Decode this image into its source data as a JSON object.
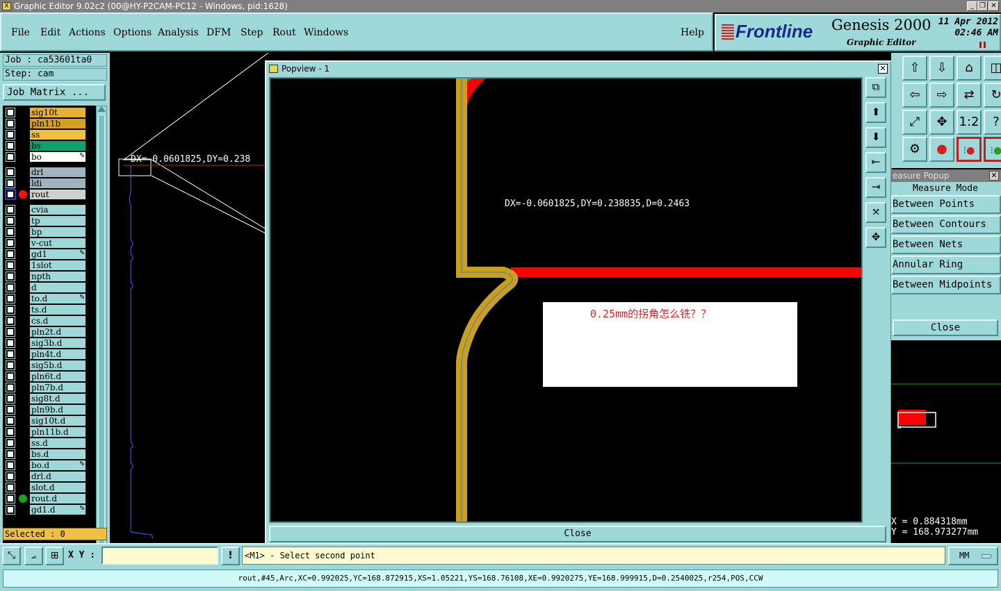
{
  "window": {
    "title": "Graphic Editor 9.02c2 (00@HY-P2CAM-PC12 - Windows, pid:1628)"
  },
  "menu": {
    "items": [
      "File",
      "Edit",
      "Actions",
      "Options",
      "Analysis",
      "DFM",
      "Step",
      "Rout",
      "Windows"
    ],
    "help": "Help"
  },
  "brand": {
    "logo": "Frontline",
    "product": "Genesis 2000",
    "subtitle": "Graphic Editor",
    "date": "11 Apr 2012",
    "time": "02:46 AM"
  },
  "job": {
    "job_line": "Job : ca53601ta0",
    "step_line": "Step: cam",
    "matrix_button": "Job Matrix ...",
    "selected": "Selected : 0"
  },
  "layers": [
    {
      "name": "sig10t",
      "color": "#e8b030",
      "dot": ""
    },
    {
      "name": "pln11b",
      "color": "#d4a020",
      "dot": ""
    },
    {
      "name": "ss",
      "color": "#f0c040",
      "dot": ""
    },
    {
      "name": "bs",
      "color": "#10a070",
      "dot": ""
    },
    {
      "name": "bo",
      "color": "#ffffff",
      "dot": "",
      "pen": true
    },
    {
      "name": "drl",
      "color": "#a0b4c0",
      "dot": ""
    },
    {
      "name": "ldi",
      "color": "#a0b4c0",
      "dot": ""
    },
    {
      "name": "rout",
      "color": "#d0d0d0",
      "dot": "#ff1010",
      "active": true
    },
    {
      "name": "cvia",
      "color": "#9fd8d8",
      "dot": ""
    },
    {
      "name": "tp",
      "color": "#9fd8d8",
      "dot": ""
    },
    {
      "name": "bp",
      "color": "#9fd8d8",
      "dot": ""
    },
    {
      "name": "v-cut",
      "color": "#9fd8d8",
      "dot": ""
    },
    {
      "name": "gd1",
      "color": "#9fd8d8",
      "dot": "",
      "pen": true
    },
    {
      "name": "1slot",
      "color": "#9fd8d8",
      "dot": ""
    },
    {
      "name": "npth",
      "color": "#9fd8d8",
      "dot": ""
    },
    {
      "name": "d",
      "color": "#9fd8d8",
      "dot": ""
    },
    {
      "name": "to.d",
      "color": "#9fd8d8",
      "dot": "",
      "pen": true
    },
    {
      "name": "ts.d",
      "color": "#9fd8d8",
      "dot": ""
    },
    {
      "name": "cs.d",
      "color": "#9fd8d8",
      "dot": ""
    },
    {
      "name": "pln2t.d",
      "color": "#9fd8d8",
      "dot": ""
    },
    {
      "name": "sig3b.d",
      "color": "#9fd8d8",
      "dot": ""
    },
    {
      "name": "pln4t.d",
      "color": "#9fd8d8",
      "dot": ""
    },
    {
      "name": "sig5b.d",
      "color": "#9fd8d8",
      "dot": ""
    },
    {
      "name": "pln6t.d",
      "color": "#9fd8d8",
      "dot": ""
    },
    {
      "name": "pln7b.d",
      "color": "#9fd8d8",
      "dot": ""
    },
    {
      "name": "sig8t.d",
      "color": "#9fd8d8",
      "dot": ""
    },
    {
      "name": "pln9b.d",
      "color": "#9fd8d8",
      "dot": ""
    },
    {
      "name": "sig10t.d",
      "color": "#9fd8d8",
      "dot": ""
    },
    {
      "name": "pln11b.d",
      "color": "#9fd8d8",
      "dot": ""
    },
    {
      "name": "ss.d",
      "color": "#9fd8d8",
      "dot": ""
    },
    {
      "name": "bs.d",
      "color": "#9fd8d8",
      "dot": ""
    },
    {
      "name": "bo.d",
      "color": "#9fd8d8",
      "dot": "",
      "pen": true
    },
    {
      "name": "drl.d",
      "color": "#9fd8d8",
      "dot": ""
    },
    {
      "name": "slot.d",
      "color": "#9fd8d8",
      "dot": ""
    },
    {
      "name": "rout.d",
      "color": "#9fd8d8",
      "dot": "#20a020"
    },
    {
      "name": "gd1.d",
      "color": "#9fd8d8",
      "dot": "",
      "pen": true
    }
  ],
  "canvas": {
    "main_measure_label": "DX=-0.0601825,DY=0.238"
  },
  "popview": {
    "title": "Popview - 1",
    "measure_label": "DX=-0.0601825,DY=0.238835,D=0.2463",
    "note": "0.25mm的拐角怎么铣？？",
    "close": "Close"
  },
  "right_tools": {
    "ratio_label": "1:2",
    "help_label": "?"
  },
  "measure_popup": {
    "title": "easure Popup",
    "header": "Measure Mode",
    "options": [
      "Between Points",
      "Between Contours",
      "Between Nets",
      "Annular Ring",
      "Between Midpoints"
    ],
    "close": "Close"
  },
  "coords": {
    "x": "X  =  0.884318mm",
    "y": "Y  =  168.973277mm"
  },
  "bottom": {
    "xy_label": "X Y :",
    "xy_value": "",
    "prompt": "<M1> - Select second point",
    "units": "MM",
    "status": "rout,#45,Arc,XC=0.992025,YC=168.872915,XS=1.05221,YS=168.76108,XE=0.9920275,YE=168.999915,D=0.2540025,r254,POS,CCW"
  }
}
